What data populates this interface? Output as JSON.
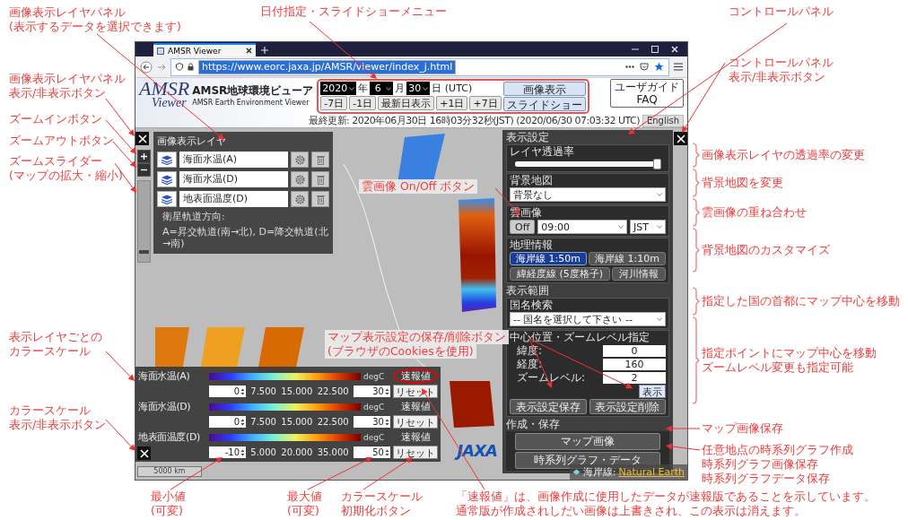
{
  "browser": {
    "tab": {
      "title": "AMSR Viewer"
    },
    "address": {
      "url": "https://www.eorc.jaxa.jp/AMSR/viewer/index_j.html",
      "selected": true
    }
  },
  "header": {
    "logo": {
      "main": "AMSR",
      "sub": "Viewer"
    },
    "title": "AMSR地球環境ビューア",
    "subtitle": "AMSR Earth Environment Viewer",
    "date": {
      "year": "2020",
      "year_unit": "年",
      "month": "6",
      "month_unit": "月",
      "day": "30",
      "day_unit": "日 (UTC)",
      "step_buttons": [
        "-7日",
        "-1日",
        "最新日表示",
        "+1日",
        "+7日"
      ],
      "action_buttons": [
        "画像表示",
        "スライドショー"
      ]
    },
    "guide_button": [
      "ユーザガイド",
      "FAQ"
    ],
    "updated": "最終更新: 2020年06月30日 16時03分32秒(JST) (2020/06/30 07:03:32 UTC)",
    "language_button": "English"
  },
  "zoom_slider": {
    "level": 0.1
  },
  "layer_panel": {
    "title": "画像表示レイヤ",
    "layers": [
      {
        "name": "海面水温(A)"
      },
      {
        "name": "海面水温(D)"
      },
      {
        "name": "地表面温度(D)"
      }
    ],
    "note": [
      "衛星軌道方向:",
      "A=昇交軌道(南→北), D=降交軌道(北→南)"
    ]
  },
  "control_panel": {
    "title": "表示設定",
    "opacity": {
      "label": "レイヤ透過率",
      "level": 1
    },
    "background": {
      "label": "背景地図",
      "value": "背景なし"
    },
    "cloud": {
      "label": "雲画像",
      "button": "Off",
      "on": false,
      "time": "09:00",
      "zone": "JST"
    },
    "geo": {
      "label": "地理情報",
      "toggles": [
        {
          "label": "海岸線 1:50m",
          "selected": true
        },
        {
          "label": "海岸線 1:10m",
          "selected": false
        },
        {
          "label": "緯経度線 (5度格子)",
          "selected": false
        },
        {
          "label": "河川情報",
          "selected": false
        }
      ]
    },
    "range": {
      "label": "表示範囲",
      "country": {
        "label": "国名検索",
        "value": "-- 国名を選択して下さい --"
      },
      "center": {
        "label": "中心位置・ズームレベル指定",
        "fields": [
          {
            "label": "緯度:",
            "value": "0"
          },
          {
            "label": "経度:",
            "value": "160"
          },
          {
            "label": "ズームレベル:",
            "value": "2"
          }
        ],
        "apply": "表示"
      },
      "save": "表示設定保存",
      "delete": "表示設定削除"
    },
    "export": {
      "label": "作成・保存",
      "buttons": [
        "マップ画像",
        "時系列グラフ・データ"
      ]
    }
  },
  "color_scales": [
    {
      "name": "海面水温(A)",
      "unit": "degC",
      "status": "速報値",
      "circled": true,
      "min": "0",
      "ticks": [
        "7.500",
        "15.000",
        "22.500"
      ],
      "max": "30",
      "reset": "リセット"
    },
    {
      "name": "海面水温(D)",
      "unit": "degC",
      "status": "速報値",
      "circled": false,
      "min": "0",
      "ticks": [
        "7.500",
        "15.000",
        "22.500"
      ],
      "max": "30",
      "reset": "リセット"
    },
    {
      "name": "地表面温度(D)",
      "unit": "degC",
      "status": "速報値",
      "circled": false,
      "min": "-10",
      "ticks": [
        "5.000",
        "20.000",
        "35.000"
      ],
      "max": "50",
      "reset": "リセット"
    }
  ],
  "map": {
    "scale": "5000 km",
    "attribution": {
      "label": "海岸線:",
      "link": "Natural Earth"
    },
    "logo": "JAXA"
  },
  "annotations": [
    {
      "kind": "label",
      "lines": [
        "画像表示レイヤパネル"
      ],
      "note": "(表示するデータを選択できます)"
    },
    {
      "kind": "label",
      "lines": [
        "日付指定・スライドショーメニュー"
      ]
    },
    {
      "kind": "label",
      "lines": [
        "コントロールパネル"
      ]
    },
    {
      "kind": "label",
      "lines": [
        "コントロールパネル",
        "表示/非表示ボタン"
      ]
    },
    {
      "kind": "label",
      "lines": [
        "画像表示レイヤパネル",
        "表示/非表示ボタン"
      ]
    },
    {
      "kind": "label",
      "lines": [
        "ズームインボタン"
      ]
    },
    {
      "kind": "label",
      "lines": [
        "ズームアウトボタン"
      ]
    },
    {
      "kind": "label",
      "lines": [
        "ズームスライダー"
      ],
      "note": "(マップの拡大・縮小)"
    },
    {
      "kind": "callout",
      "lines": [
        "雲画像 On/Off ボタン"
      ]
    },
    {
      "kind": "label",
      "lines": [
        "画像表示レイヤの透過率の変更"
      ]
    },
    {
      "kind": "label",
      "lines": [
        "背景地図を変更"
      ]
    },
    {
      "kind": "label",
      "lines": [
        "雲画像の重ね合わせ"
      ]
    },
    {
      "kind": "label",
      "lines": [
        "背景地図のカスタマイズ"
      ]
    },
    {
      "kind": "label",
      "lines": [
        "指定した国の首都にマップ中心を移動"
      ]
    },
    {
      "kind": "callout",
      "lines": [
        "マップ表示設定の保存/削除ボタン",
        "(ブラウザのCookiesを使用)"
      ]
    },
    {
      "kind": "label",
      "lines": [
        "指定ポイントにマップ中心を移動",
        "ズームレベル変更も指定可能"
      ]
    },
    {
      "kind": "label",
      "lines": [
        "表示レイヤごとの",
        "カラースケール"
      ]
    },
    {
      "kind": "label",
      "lines": [
        "カラースケール",
        "表示/非表示ボタン"
      ]
    },
    {
      "kind": "label",
      "lines": [
        "マップ画像保存"
      ]
    },
    {
      "kind": "label",
      "lines": [
        "任意地点の時系列グラフ作成",
        "時系列グラフ画像保存",
        "時系列グラフデータ保存"
      ]
    },
    {
      "kind": "label",
      "lines": [
        "最小値",
        "(可変)"
      ]
    },
    {
      "kind": "label",
      "lines": [
        "最大値",
        "(可変)"
      ]
    },
    {
      "kind": "label",
      "lines": [
        "カラースケール",
        "初期化ボタン"
      ]
    },
    {
      "kind": "label",
      "lines": [
        "「速報値」は、画像作成に使用したデータが速報版であることを示しています。",
        "通常版が作成されしだい画像は上書きされ、この表示は消えます。"
      ]
    }
  ]
}
